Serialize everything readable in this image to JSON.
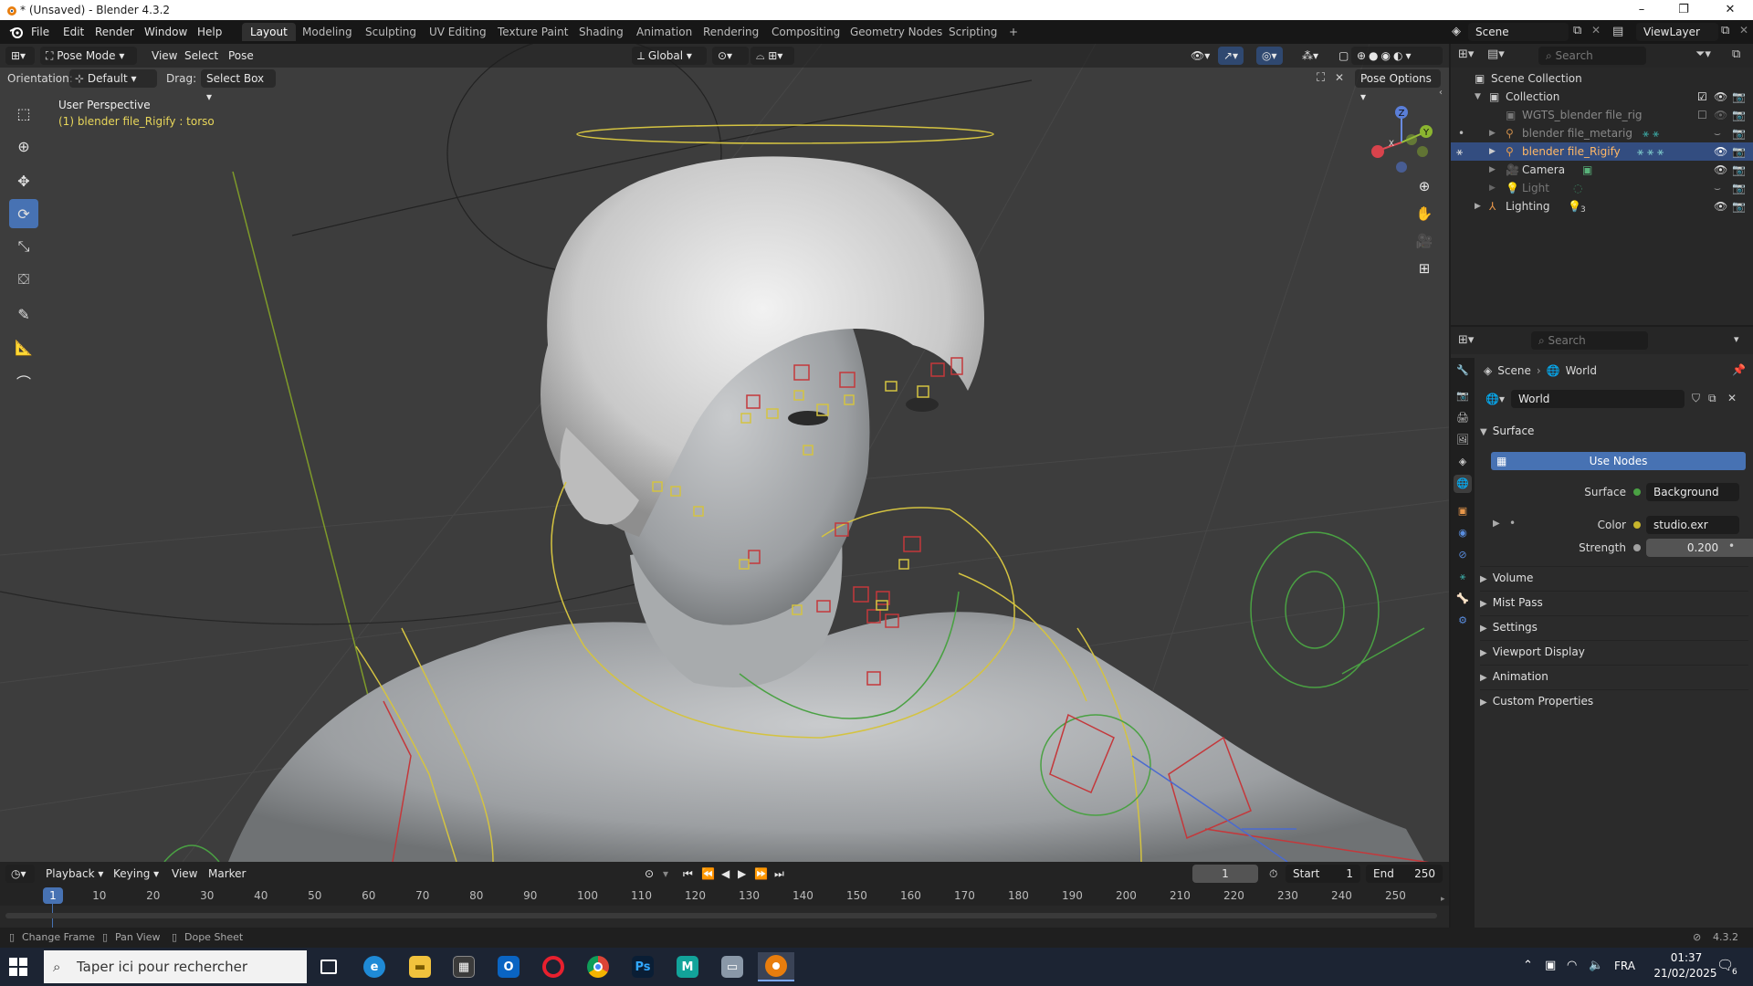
{
  "window": {
    "title": "* (Unsaved) - Blender 4.3.2",
    "controls": [
      "–",
      "❐",
      "✕"
    ]
  },
  "menu": [
    "File",
    "Edit",
    "Render",
    "Window",
    "Help"
  ],
  "workspaces": {
    "tabs": [
      "Layout",
      "Modeling",
      "Sculpting",
      "UV Editing",
      "Texture Paint",
      "Shading",
      "Animation",
      "Rendering",
      "Compositing",
      "Geometry Nodes",
      "Scripting"
    ],
    "active": "Layout",
    "add": "+"
  },
  "scene_selector": {
    "scene": "Scene",
    "view_layer": "ViewLayer"
  },
  "viewport": {
    "mode": "Pose Mode",
    "menus": [
      "View",
      "Select",
      "Pose"
    ],
    "transform_orientation": "Global",
    "orientation_label": "Orientation:",
    "orientation_value": "Default",
    "drag_label": "Drag:",
    "drag_value": "Select Box",
    "pose_options": "Pose Options",
    "overlay_title": "User Perspective",
    "overlay_subtitle": "(1) blender file_Rigify : torso",
    "gizmo": {
      "z": "Z",
      "y": "Y",
      "x": "X"
    }
  },
  "outliner": {
    "search_placeholder": "Search",
    "items": [
      {
        "label": "Scene Collection"
      },
      {
        "label": "Collection"
      },
      {
        "label": "WGTS_blender file_rig"
      },
      {
        "label": "blender file_metarig"
      },
      {
        "label": "blender file_Rigify"
      },
      {
        "label": "Camera"
      },
      {
        "label": "Light"
      },
      {
        "label": "Lighting"
      }
    ],
    "lighting_count": "3"
  },
  "properties": {
    "search_placeholder": "Search",
    "breadcrumb": [
      "Scene",
      "World"
    ],
    "world_name": "World",
    "surface_panel": "Surface",
    "use_nodes": "Use Nodes",
    "surface_label": "Surface",
    "surface_value": "Background",
    "color_label": "Color",
    "color_value": "studio.exr",
    "strength_label": "Strength",
    "strength_value": "0.200",
    "panels": [
      "Volume",
      "Mist Pass",
      "Settings",
      "Viewport Display",
      "Animation",
      "Custom Properties"
    ]
  },
  "timeline": {
    "menus": [
      "Playback",
      "Keying",
      "View",
      "Marker"
    ],
    "current_frame": "1",
    "start_label": "Start",
    "start": "1",
    "end_label": "End",
    "end": "250",
    "ticks": [
      "1",
      "10",
      "20",
      "30",
      "40",
      "50",
      "60",
      "70",
      "80",
      "90",
      "100",
      "110",
      "120",
      "130",
      "140",
      "150",
      "160",
      "170",
      "180",
      "190",
      "200",
      "210",
      "220",
      "230",
      "240",
      "250"
    ]
  },
  "statusbar": {
    "hints": [
      "Change Frame",
      "Pan View",
      "Dope Sheet"
    ],
    "version": "4.3.2"
  },
  "taskbar": {
    "search_placeholder": "Taper ici pour rechercher",
    "language": "FRA",
    "time": "01:37",
    "date": "21/02/2025",
    "notifications": "6"
  },
  "colors": {
    "accent": "#4772b3",
    "selected_row": "#334d80",
    "bone_yellow": "#d4c341",
    "bone_red": "#c4383b",
    "bone_green": "#4aa143"
  }
}
